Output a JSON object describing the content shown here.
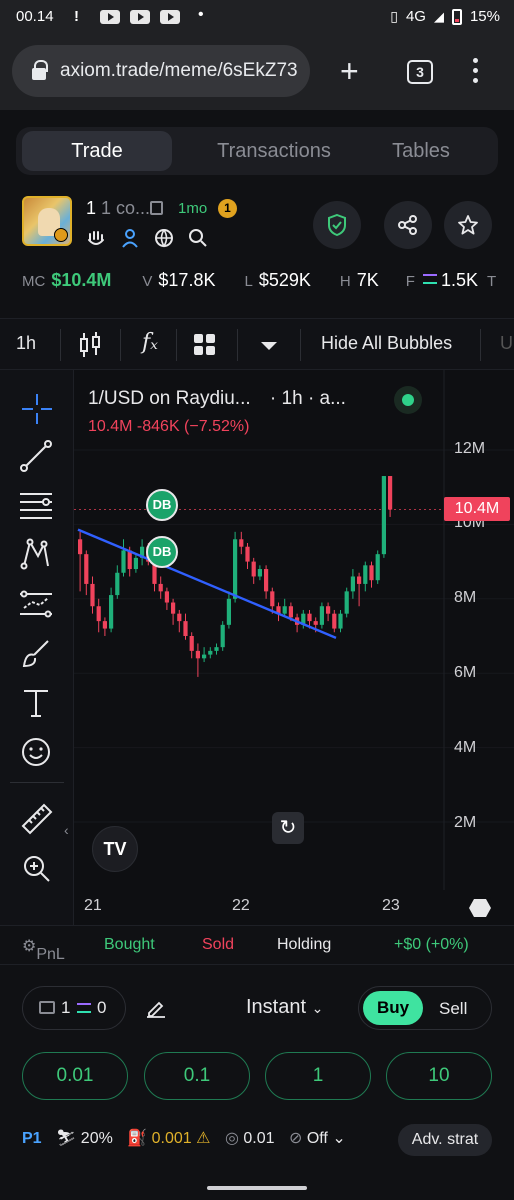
{
  "status_bar": {
    "time": "00.14",
    "network": "4G",
    "battery": "15%"
  },
  "browser": {
    "url": "axiom.trade/meme/6sEkZ73",
    "tab_count": "3"
  },
  "tabs": [
    {
      "label": "Trade",
      "active": true
    },
    {
      "label": "Transactions",
      "active": false
    },
    {
      "label": "Tables",
      "active": false
    }
  ],
  "token": {
    "name_main": "1",
    "name_sub": "1 co...",
    "age": "1mo",
    "badge_num": "1"
  },
  "stats": {
    "mc_label": "MC",
    "mc_value": "$10.4M",
    "v_label": "V",
    "v_value": "$17.8K",
    "l_label": "L",
    "l_value": "$529K",
    "h_label": "H",
    "h_value": "7K",
    "f_label": "F",
    "f_value": "1.5K",
    "t_label": "T"
  },
  "chart_toolbar": {
    "interval": "1h",
    "indicators_label": "fₓ",
    "hide_bubbles": "Hide All Bubbles",
    "cut_label": "U"
  },
  "chart": {
    "legend_title": "1/USD on Raydiu...",
    "legend_interval": "· 1h · a...",
    "legend_change": "10.4M  -846K (−7.52%)",
    "price_tag": "10.4M",
    "db1": "DB",
    "db2": "DB",
    "tv_logo": "TV"
  },
  "chart_data": {
    "type": "candlestick",
    "title": "1/USD on Raydiu...",
    "y_ticks": [
      "12M",
      "10M",
      "8M",
      "6M",
      "4M",
      "2M"
    ],
    "x_ticks": [
      "21",
      "22",
      "23"
    ],
    "ylim": [
      1200000,
      13000000
    ],
    "last_price": 10400000,
    "change": -846000,
    "change_pct": -7.52,
    "candles_approx": [
      [
        9.6,
        9.2,
        8.2,
        9.8
      ],
      [
        9.2,
        8.4,
        8.1,
        9.3
      ],
      [
        8.4,
        7.8,
        7.6,
        8.6
      ],
      [
        7.8,
        7.4,
        7.1,
        8.0
      ],
      [
        7.4,
        7.2,
        7.0,
        7.5
      ],
      [
        7.2,
        8.1,
        7.1,
        8.3
      ],
      [
        8.1,
        8.7,
        8.0,
        8.9
      ],
      [
        8.7,
        9.3,
        8.6,
        9.6
      ],
      [
        9.3,
        8.8,
        8.6,
        9.4
      ],
      [
        8.8,
        9.1,
        8.7,
        9.2
      ],
      [
        9.1,
        9.4,
        8.9,
        9.6
      ],
      [
        9.4,
        9.0,
        8.9,
        9.5
      ],
      [
        9.0,
        8.4,
        8.2,
        9.1
      ],
      [
        8.4,
        8.2,
        8.0,
        8.6
      ],
      [
        8.2,
        7.9,
        7.7,
        8.3
      ],
      [
        7.9,
        7.6,
        7.3,
        8.0
      ],
      [
        7.6,
        7.4,
        7.1,
        7.7
      ],
      [
        7.4,
        7.0,
        6.9,
        7.6
      ],
      [
        7.0,
        6.6,
        6.4,
        7.1
      ],
      [
        6.6,
        6.4,
        5.9,
        6.8
      ],
      [
        6.4,
        6.5,
        6.3,
        6.7
      ],
      [
        6.5,
        6.6,
        6.4,
        6.7
      ],
      [
        6.6,
        6.7,
        6.5,
        6.8
      ],
      [
        6.7,
        7.3,
        6.6,
        7.4
      ],
      [
        7.3,
        8.0,
        7.2,
        8.2
      ],
      [
        8.0,
        9.6,
        7.9,
        9.8
      ],
      [
        9.6,
        9.4,
        9.2,
        9.8
      ],
      [
        9.4,
        9.0,
        8.8,
        9.5
      ],
      [
        9.0,
        8.6,
        8.4,
        9.1
      ],
      [
        8.6,
        8.8,
        8.5,
        8.9
      ],
      [
        8.8,
        8.2,
        8.0,
        8.9
      ],
      [
        8.2,
        7.8,
        7.6,
        8.3
      ],
      [
        7.8,
        7.6,
        7.4,
        7.9
      ],
      [
        7.6,
        7.8,
        7.5,
        8.0
      ],
      [
        7.8,
        7.5,
        7.4,
        7.9
      ],
      [
        7.5,
        7.3,
        7.1,
        7.6
      ],
      [
        7.3,
        7.6,
        7.2,
        7.7
      ],
      [
        7.6,
        7.4,
        7.2,
        7.7
      ],
      [
        7.4,
        7.3,
        7.1,
        7.5
      ],
      [
        7.3,
        7.8,
        7.2,
        7.9
      ],
      [
        7.8,
        7.6,
        7.4,
        7.9
      ],
      [
        7.6,
        7.2,
        7.1,
        7.7
      ],
      [
        7.2,
        7.6,
        7.1,
        7.7
      ],
      [
        7.6,
        8.2,
        7.5,
        8.3
      ],
      [
        8.2,
        8.6,
        8.0,
        8.8
      ],
      [
        8.6,
        8.4,
        7.8,
        8.7
      ],
      [
        8.4,
        8.9,
        8.2,
        9.0
      ],
      [
        8.9,
        8.5,
        8.3,
        9.0
      ],
      [
        8.5,
        9.2,
        8.4,
        9.3
      ],
      [
        9.2,
        11.3,
        9.1,
        11.3
      ],
      [
        11.3,
        10.4,
        10.2,
        11.3
      ]
    ],
    "grid": true,
    "annotations": [
      "DB",
      "DB",
      "trend line"
    ]
  },
  "pnl": {
    "pnl_label": "PnL",
    "bought_label": "Bought",
    "sold_label": "Sold",
    "holding_label": "Holding",
    "value": "+$0 (+0%)"
  },
  "trade": {
    "wallet_count": "1",
    "wallet_balance": "0",
    "mode": "Instant",
    "buy_label": "Buy",
    "sell_label": "Sell",
    "amounts": [
      "0.01",
      "0.1",
      "1",
      "10"
    ],
    "preset": "P1",
    "slippage": "20%",
    "priority": "0.001",
    "bribe": "0.01",
    "mev": "Off",
    "adv_label": "Adv. strat"
  },
  "colors": {
    "green": "#3ec97a",
    "red": "#f0435c",
    "buy": "#3fe3a0",
    "trendline": "#3060ff",
    "bg": "#101114"
  }
}
